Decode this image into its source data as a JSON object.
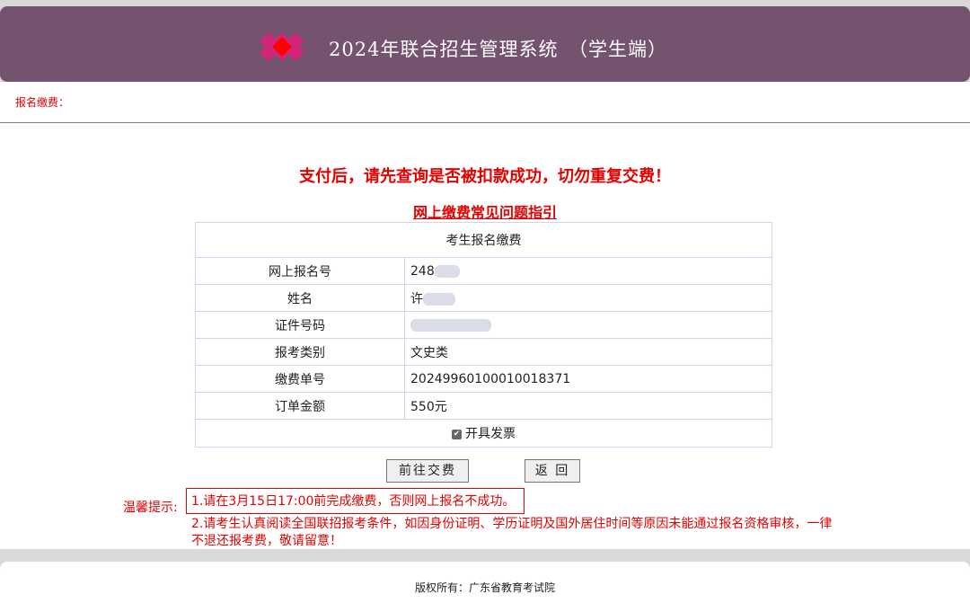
{
  "header": {
    "title": "2024年联合招生管理系统　（学生端）",
    "logo_icon": "red-diamond-logo-icon"
  },
  "breadcrumb": "报名缴费：",
  "warning": "支付后，请先查询是否被扣款成功，切勿重复交费！",
  "faq_link": "网上缴费常见问题指引",
  "table": {
    "caption": "考生报名缴费",
    "rows": [
      {
        "label": "网上报名号",
        "value": "248"
      },
      {
        "label": "姓名",
        "value": "许"
      },
      {
        "label": "证件号码",
        "value": ""
      },
      {
        "label": "报考类别",
        "value": "文史类"
      },
      {
        "label": "缴费单号",
        "value": "20249960100010018371"
      },
      {
        "label": "订单金额",
        "value": "550元"
      }
    ],
    "invoice_label": "开具发票",
    "invoice_checked": true
  },
  "buttons": {
    "pay": "前往交费",
    "back": "返 回"
  },
  "tips": {
    "label": "温馨提示:",
    "item1": "1.请在3月15日17:00前完成缴费，否则网上报名不成功。",
    "item2": "2.请考生认真阅读全国联招报考条件，如因身份证明、学历证明及国外居住时间等原因未能通过报名资格审核，一律不退还报考费，敬请留意！"
  },
  "footer": {
    "copyright": "版权所有：广东省教育考试院"
  },
  "colors": {
    "header_bg": "#74536f",
    "accent_red": "#e60000"
  }
}
